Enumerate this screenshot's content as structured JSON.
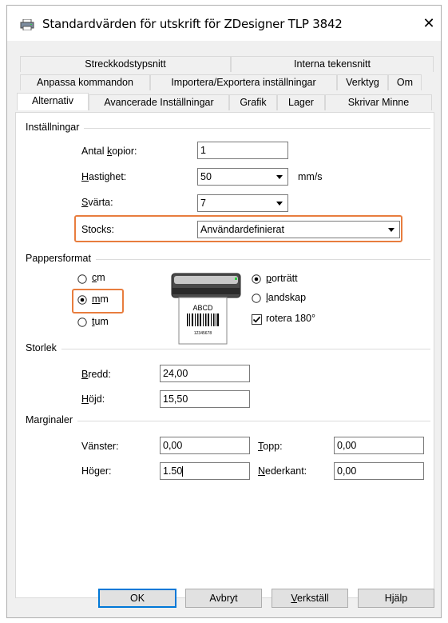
{
  "window": {
    "title": "Standardvärden för utskrift för ZDesigner TLP 3842",
    "close_symbol": "✕"
  },
  "tabs": {
    "row1": [
      "Streckkodstypsnitt",
      "Interna tekensnitt"
    ],
    "row2": [
      "Anpassa kommandon",
      "Importera/Exportera inställningar",
      "Verktyg",
      "Om"
    ],
    "row3": [
      "Alternativ",
      "Avancerade Inställningar",
      "Grafik",
      "Lager",
      "Skrivar Minne"
    ],
    "active": "Alternativ"
  },
  "settings": {
    "group_label": "Inställningar",
    "copies_label_pre": "Antal ",
    "copies_label_u": "k",
    "copies_label_post": "opior:",
    "copies_value": "1",
    "speed_label_u": "H",
    "speed_label_post": "astighet:",
    "speed_value": "50",
    "speed_unit": "mm/s",
    "darkness_label_u": "S",
    "darkness_label_post": "värta:",
    "darkness_value": "7",
    "stocks_label": "Stocks:",
    "stocks_value": "Användardefinierat"
  },
  "paper": {
    "group_label": "Pappersformat",
    "unit_cm_u": "c",
    "unit_cm_post": "m",
    "unit_mm_u": "m",
    "unit_mm_post": "m",
    "unit_tum_u": "t",
    "unit_tum_post": "um",
    "selected_unit": "mm",
    "orient_portrait_u": "p",
    "orient_portrait_post": "orträtt",
    "orient_landscape_u": "l",
    "orient_landscape_post": "andskap",
    "selected_orientation": "porträtt",
    "rotate_label": "rotera 180°",
    "rotate_checked": true,
    "preview_label_text": "ABCD",
    "preview_small_text": "12345678"
  },
  "size": {
    "group_label": "Storlek",
    "width_label_u": "B",
    "width_label_post": "redd:",
    "width_value": "24,00",
    "height_label_u": "H",
    "height_label_post": "öjd:",
    "height_value": "15,50"
  },
  "margins": {
    "group_label": "Marginaler",
    "left_label": "Vänster:",
    "left_value": "0,00",
    "top_label_u": "T",
    "top_label_post": "opp:",
    "top_value": "0,00",
    "right_label": "Höger:",
    "right_value": "1.50",
    "bottom_label_u": "N",
    "bottom_label_post": "ederkant:",
    "bottom_value": "0,00"
  },
  "buttons": {
    "ok": "OK",
    "cancel": "Avbryt",
    "apply_u": "V",
    "apply_post": "erkställ",
    "help": "Hjälp"
  },
  "colors": {
    "highlight": "#e87d3e",
    "default_button_border": "#0078d7"
  },
  "icons": {
    "title": "printer-icon",
    "close": "close-icon",
    "combo": "chevron-down-icon"
  }
}
